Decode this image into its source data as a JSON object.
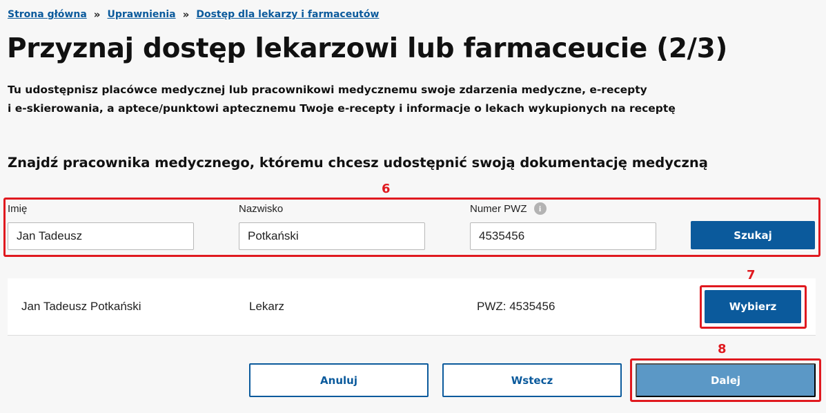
{
  "breadcrumb": {
    "items": [
      "Strona główna",
      "Uprawnienia",
      "Dostęp dla lekarzy i farmaceutów"
    ],
    "separator": "»"
  },
  "page": {
    "title": "Przyznaj dostęp lekarzowi lub farmaceucie (2/3)",
    "intro_line1": "Tu udostępnisz placówce medycznej lub pracownikowi medycznemu swoje zdarzenia medyczne, e-recepty",
    "intro_line2": "i e-skierowania, a aptece/punktowi aptecznemu Twoje e-recepty i informacje o lekach wykupionych na receptę",
    "search_heading": "Znajdź pracownika medycznego, któremu chcesz udostępnić swoją dokumentację medyczną"
  },
  "annotations": {
    "a6": "6",
    "a7": "7",
    "a8": "8"
  },
  "search": {
    "first_name_label": "Imię",
    "first_name_value": "Jan Tadeusz",
    "last_name_label": "Nazwisko",
    "last_name_value": "Potkański",
    "pwz_label": "Numer PWZ",
    "pwz_value": "4535456",
    "search_button": "Szukaj"
  },
  "result": {
    "name": "Jan Tadeusz Potkański",
    "role": "Lekarz",
    "pwz": "PWZ: 4535456",
    "select_button": "Wybierz"
  },
  "footer": {
    "cancel": "Anuluj",
    "back": "Wstecz",
    "next": "Dalej"
  },
  "colors": {
    "primary": "#0b5a9c",
    "disabled": "#5b98c6",
    "annotation": "#e0191f"
  },
  "icons": {
    "info": "info-icon"
  }
}
